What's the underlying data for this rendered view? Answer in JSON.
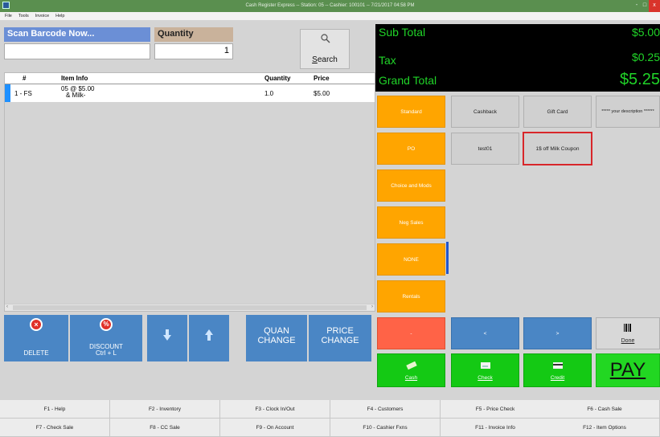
{
  "window": {
    "title": "Cash Register Express -- Station: 05 -- Cashier: 100101 -- 7/21/2017 04:58 PM",
    "controls": [
      "-",
      "□",
      "x"
    ]
  },
  "menu": [
    "File",
    "Tools",
    "Invoice",
    "Help"
  ],
  "entry": {
    "scan_label": "Scan Barcode Now...",
    "scan_value": "",
    "qty_label": "Quantity",
    "qty_value": "1",
    "search_label_ul": "S",
    "search_label_rest": "earch"
  },
  "grid": {
    "headers": [
      "#",
      "Item Info",
      "Quantity",
      "Price"
    ],
    "rows": [
      {
        "num": "1 - FS",
        "info_line1": "05 @ $5.00",
        "info_line2": "& Milk-",
        "quantity": "1.0",
        "price": "$5.00"
      }
    ]
  },
  "actions": {
    "delete": "DELETE",
    "discount_1": "DISCOUNT",
    "discount_2": "Ctrl + L",
    "quan_1": "QUAN",
    "quan_2": "CHANGE",
    "price_1": "PRICE",
    "price_2": "CHANGE"
  },
  "totals": {
    "subtotal_label": "Sub Total",
    "subtotal_value": "$5.00",
    "tax_label": "Tax",
    "tax_value": "$0.25",
    "grand_label": "Grand Total",
    "grand_value": "$5.25",
    "color": "#20d428"
  },
  "categories": [
    "Standard",
    "PO",
    "Choice and Mods",
    "Neg Sales",
    "NONE",
    "Rentals"
  ],
  "options": {
    "cashback": "Cashback",
    "giftcard": "Gift Card",
    "description": "***** your description ******",
    "test01": "test01",
    "coupon": "1$ off Milk Coupon"
  },
  "nav": {
    "minus": "-",
    "left": "<",
    "right": ">"
  },
  "tender": {
    "cash": "Cash",
    "check": "Check",
    "credit": "Credit",
    "pay": "PAY",
    "done": "Done"
  },
  "fkeys": [
    "F1 - Help",
    "F2 - Inventory",
    "F3 - Clock In/Out",
    "F4 - Customers",
    "F5 - Price Check",
    "F6 - Cash Sale",
    "F7 - Check Sale",
    "F8 - CC Sale",
    "F9 - On Account",
    "F10 - Cashier Fxns",
    "F11 - Invoice Info",
    "F12 - Item Options"
  ],
  "colors": {
    "category": "#ffa500",
    "action_blue": "#4a86c5",
    "tender_green": "#14c914",
    "highlight": "#d8262a"
  }
}
